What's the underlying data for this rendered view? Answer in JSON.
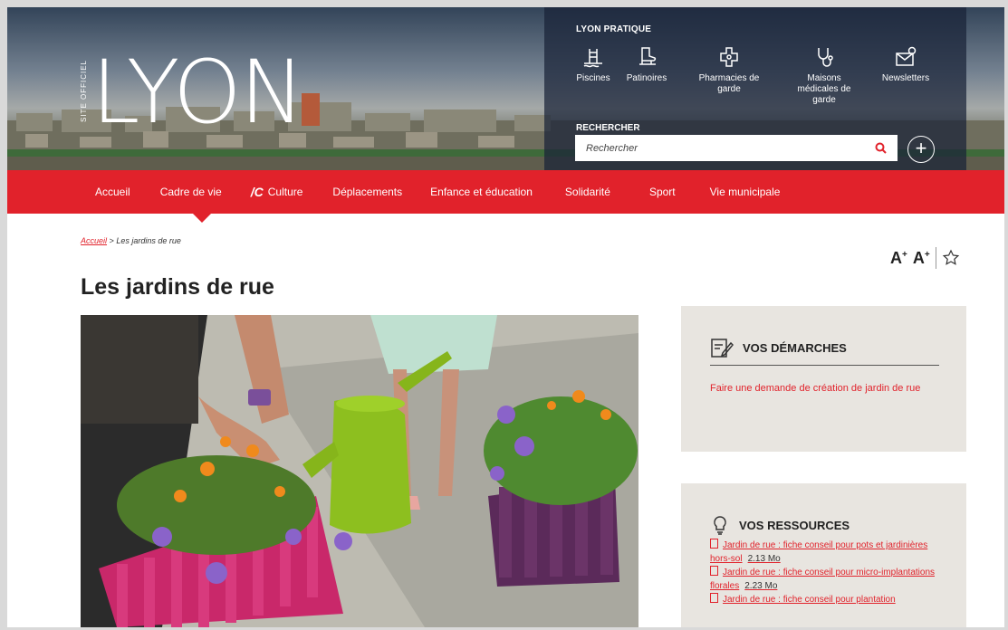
{
  "header": {
    "logo_side_text": "SITE OFFICIEL",
    "logo_text": "LYON",
    "pratique_title": "LYON PRATIQUE",
    "quick_links": [
      {
        "label": "Piscines",
        "icon": "pool-ladder-icon"
      },
      {
        "label": "Patinoires",
        "icon": "skate-icon"
      },
      {
        "label": "Pharmacies de garde",
        "icon": "pharmacy-cross-icon"
      },
      {
        "label": "Maisons médicales de garde",
        "icon": "stethoscope-icon"
      },
      {
        "label": "Newsletters",
        "icon": "envelope-icon"
      }
    ],
    "search_title": "RECHERCHER",
    "search_placeholder": "Rechercher"
  },
  "nav": {
    "items": [
      {
        "label": "Accueil"
      },
      {
        "label": "Cadre de vie"
      },
      {
        "label": "Culture",
        "prefix": "/C"
      },
      {
        "label": "Déplacements"
      },
      {
        "label": "Enfance et éducation"
      },
      {
        "label": "Solidarité"
      },
      {
        "label": "Sport"
      },
      {
        "label": "Vie municipale"
      }
    ]
  },
  "breadcrumb": {
    "home": "Accueil",
    "separator": ">",
    "current": "Les jardins de rue"
  },
  "page": {
    "title": "Les jardins de rue",
    "font_small": "A",
    "font_big": "A",
    "font_sup": "+"
  },
  "demarches": {
    "title": "VOS DÉMARCHES",
    "link": "Faire une demande de création de jardin de rue"
  },
  "ressources": {
    "title": "VOS RESSOURCES",
    "items": [
      {
        "label": "Jardin de rue : fiche conseil pour pots et jardinières hors-sol",
        "size": "2.13 Mo"
      },
      {
        "label": "Jardin de rue : fiche conseil pour micro-implantations florales",
        "size": "2.23 Mo"
      },
      {
        "label": "Jardin de rue : fiche conseil pour plantation",
        "size": ""
      }
    ]
  },
  "colors": {
    "brand_red": "#e1222b",
    "card_bg": "#e8e5e0"
  }
}
